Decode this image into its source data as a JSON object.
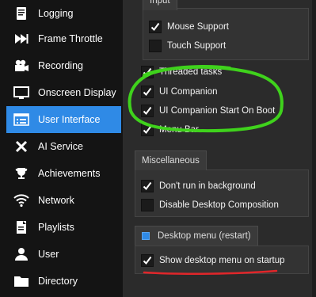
{
  "sidebar": {
    "items": [
      {
        "label": "Logging",
        "icon": "logging-icon"
      },
      {
        "label": "Frame Throttle",
        "icon": "frame-throttle-icon"
      },
      {
        "label": "Recording",
        "icon": "recording-icon"
      },
      {
        "label": "Onscreen Display",
        "icon": "onscreen-display-icon"
      },
      {
        "label": "User Interface",
        "icon": "user-interface-icon",
        "active": true
      },
      {
        "label": "AI Service",
        "icon": "ai-service-icon"
      },
      {
        "label": "Achievements",
        "icon": "achievements-icon"
      },
      {
        "label": "Network",
        "icon": "network-icon"
      },
      {
        "label": "Playlists",
        "icon": "playlists-icon"
      },
      {
        "label": "User",
        "icon": "user-icon"
      },
      {
        "label": "Directory",
        "icon": "directory-icon"
      }
    ]
  },
  "input_group": {
    "title": "Input",
    "options": [
      {
        "label": "Mouse Support",
        "checked": true
      },
      {
        "label": "Touch Support",
        "checked": false
      }
    ]
  },
  "main_options": [
    {
      "label": "Threaded tasks",
      "checked": true
    },
    {
      "label": "UI Companion",
      "checked": true
    },
    {
      "label": "UI Companion Start On Boot",
      "checked": true
    },
    {
      "label": "Menu Bar",
      "checked": true
    }
  ],
  "misc_group": {
    "title": "Miscellaneous",
    "options": [
      {
        "label": "Don't run in background",
        "checked": true
      },
      {
        "label": "Disable Desktop Composition",
        "checked": false
      }
    ]
  },
  "desktop_group": {
    "title": "Desktop menu (restart)",
    "title_checked": true,
    "options": [
      {
        "label": "Show desktop menu on startup",
        "checked": true
      }
    ]
  },
  "colors": {
    "accent": "#2f8ae6",
    "annotation_green": "#3fd21c",
    "annotation_red": "#e0262a"
  }
}
